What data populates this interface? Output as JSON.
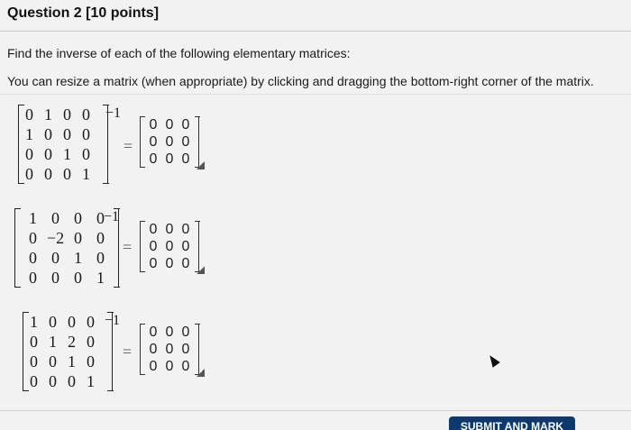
{
  "question": {
    "title": "Question 2 [10 points]",
    "instruction": "Find the inverse of each of the following elementary matrices:",
    "resize_hint": "You can resize a matrix (when appropriate) by clicking and dragging the bottom-right corner of the matrix."
  },
  "problems": [
    {
      "matrix": [
        [
          "0",
          "1",
          "0",
          "0"
        ],
        [
          "1",
          "0",
          "0",
          "0"
        ],
        [
          "0",
          "0",
          "1",
          "0"
        ],
        [
          "0",
          "0",
          "0",
          "1"
        ]
      ],
      "exponent": "−1",
      "equals": "=",
      "answer": [
        [
          "0",
          "0",
          "0"
        ],
        [
          "0",
          "0",
          "0"
        ],
        [
          "0",
          "0",
          "0"
        ]
      ]
    },
    {
      "matrix": [
        [
          "1",
          "0",
          "0",
          "0"
        ],
        [
          "0",
          "−2",
          "0",
          "0"
        ],
        [
          "0",
          "0",
          "1",
          "0"
        ],
        [
          "0",
          "0",
          "0",
          "1"
        ]
      ],
      "exponent": "−1",
      "equals": "=",
      "answer": [
        [
          "0",
          "0",
          "0"
        ],
        [
          "0",
          "0",
          "0"
        ],
        [
          "0",
          "0",
          "0"
        ]
      ]
    },
    {
      "matrix": [
        [
          "1",
          "0",
          "0",
          "0"
        ],
        [
          "0",
          "1",
          "2",
          "0"
        ],
        [
          "0",
          "0",
          "1",
          "0"
        ],
        [
          "0",
          "0",
          "0",
          "1"
        ]
      ],
      "exponent": "−1",
      "equals": "=",
      "answer": [
        [
          "0",
          "0",
          "0"
        ],
        [
          "0",
          "0",
          "0"
        ],
        [
          "0",
          "0",
          "0"
        ]
      ]
    }
  ],
  "footer": {
    "submit_label": "SUBMIT AND MARK"
  }
}
